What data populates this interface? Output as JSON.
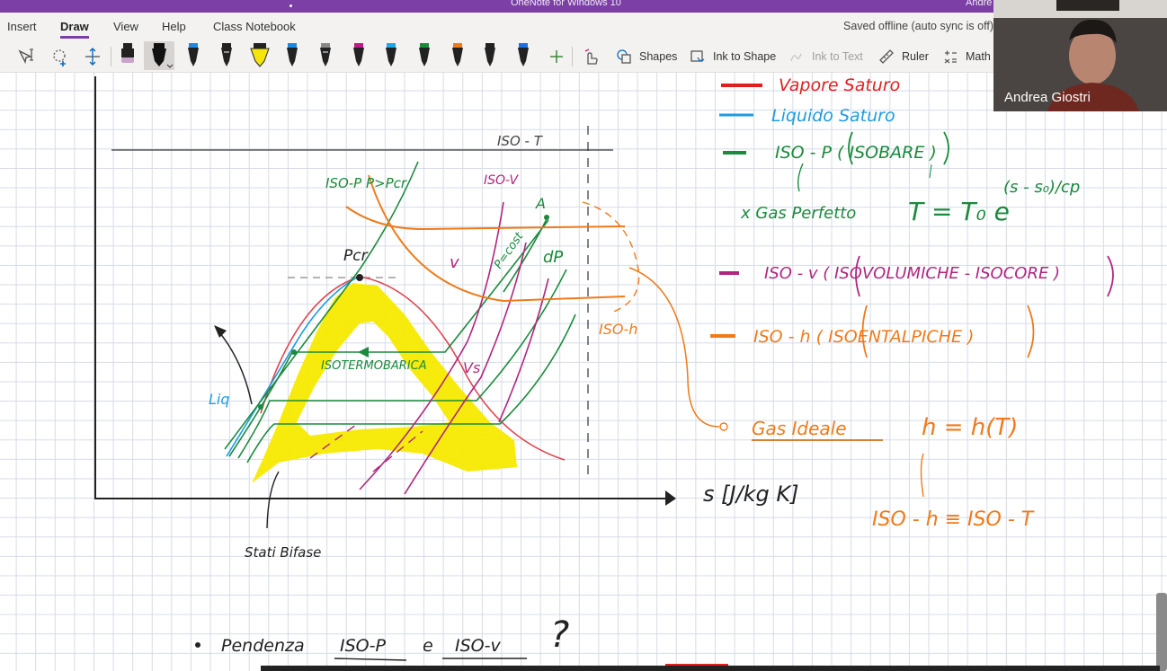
{
  "window": {
    "title": "OneNote for Windows 10",
    "user_partial": "Andre"
  },
  "menu": {
    "items": [
      "Insert",
      "Draw",
      "View",
      "Help",
      "Class Notebook"
    ],
    "active": "Draw",
    "sync_status": "Saved offline (auto sync is off)"
  },
  "toolbar": {
    "shapes_label": "Shapes",
    "ink_to_shape_label": "Ink to Shape",
    "ink_to_text_label": "Ink to Text",
    "ruler_label": "Ruler",
    "math_label": "Math"
  },
  "video": {
    "participant_name": "Andrea Giostri"
  },
  "ink_text": {
    "legend_red": "Vapore Saturo",
    "legend_blue": "Liquido Saturo",
    "legend_green": "ISO - P ( ISOBARE )",
    "gas_perfetto": "x Gas Perfetto",
    "formula_base": "T = T₀ e",
    "formula_exp": "(s - s₀)/cp",
    "legend_purple": "ISO - v ( ISOVOLUMICHE - ISOCORE )",
    "legend_orange": "ISO - h ( ISOENTALPICHE )",
    "gas_ideale": "Gas Ideale",
    "h_of_T": "h = h(T)",
    "iso_equiv": "ISO - h  ≡  ISO - T",
    "iso_t_top": "ISO - T",
    "iso_p_label": "ISO-P P>Pcr",
    "iso_v_label": "ISO-V",
    "point_a": "A",
    "v_label": "v",
    "p_cost": "P=cost",
    "dp_label": "dP",
    "pcr_label": "Pcr",
    "isotermobarica": "ISOTERMOBARICA",
    "vs_label": "Vs",
    "liq_label": "Liq",
    "iso_h_label": "ISO-h",
    "axis_label": "s [J/kg K]",
    "stati_bifase": "Stati Bifase",
    "bullet_note": "Pendenza",
    "iso_p_note": "ISO-P",
    "e_note": "e",
    "iso_v_note": "ISO-v",
    "question": "?"
  }
}
